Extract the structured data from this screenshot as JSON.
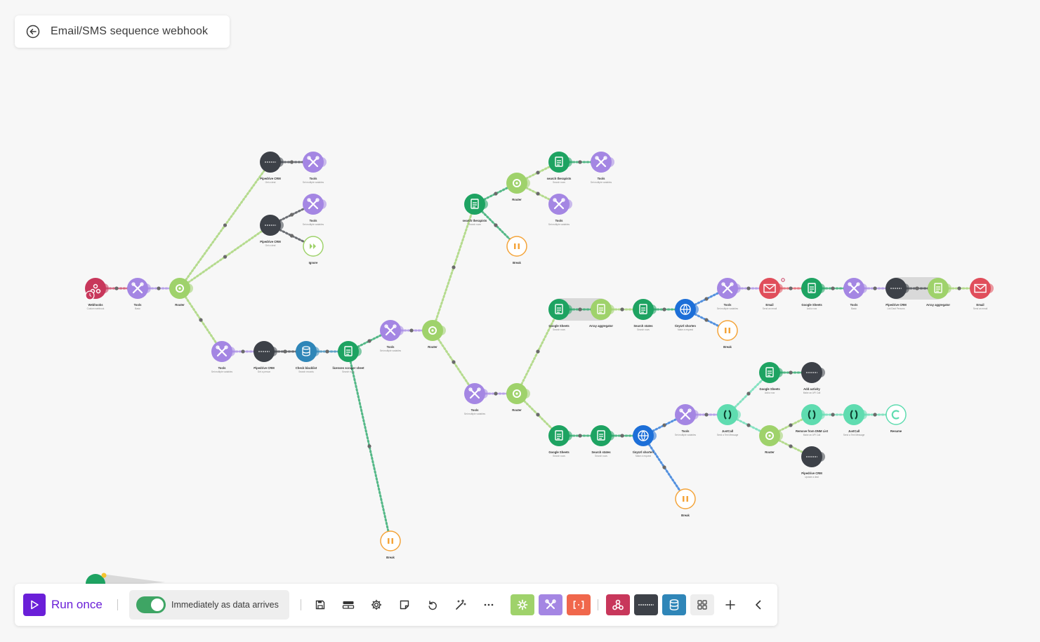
{
  "scenario": {
    "title": "Email/SMS sequence webhook"
  },
  "toolbar": {
    "run_label": "Run once",
    "schedule_label": "Immediately as data arrives",
    "schedule_enabled": true
  },
  "nodes": {
    "webhooks": {
      "label": "Webhooks",
      "sub": "Custom webhook",
      "icon": "webhooks-icon"
    },
    "tools1": {
      "label": "Tools",
      "sub": "Basic",
      "icon": "tools-icon"
    },
    "router1": {
      "label": "Router",
      "icon": "router-icon"
    },
    "pipedrive_a": {
      "label": "Pipedrive CRM",
      "sub": "Get a deal",
      "icon": "pipedrive-icon"
    },
    "tools_a": {
      "label": "Tools",
      "sub": "Set multiple variables",
      "icon": "tools-icon"
    },
    "pipedrive_b": {
      "label": "Pipedrive CRM",
      "sub": "Get a deal",
      "icon": "pipedrive-icon"
    },
    "tools_b": {
      "label": "Tools",
      "sub": "Set multiple variables",
      "icon": "tools-icon"
    },
    "ignore": {
      "label": "Ignore",
      "icon": "ignore-icon"
    },
    "tools_c": {
      "label": "Tools",
      "sub": "Set multiple variables",
      "icon": "tools-icon"
    },
    "pipedrive_c": {
      "label": "Pipedrive CRM",
      "sub": "Get a person",
      "icon": "pipedrive-icon"
    },
    "check_blacklist": {
      "label": "Check blacklist",
      "sub": "Search records",
      "icon": "datastore-icon"
    },
    "licenses": {
      "label": "licenses scraper sheet",
      "sub": "Search rows",
      "icon": "sheets-icon"
    },
    "tools_d": {
      "label": "Tools",
      "sub": "Set multiple variables",
      "icon": "tools-icon"
    },
    "router2": {
      "label": "Router",
      "icon": "router-icon"
    },
    "search_therapists1": {
      "label": "search therapists",
      "sub": "Search rows",
      "icon": "sheets-icon"
    },
    "router3": {
      "label": "Router",
      "icon": "router-icon"
    },
    "search_therapists2": {
      "label": "search therapists",
      "sub": "Search rows",
      "icon": "sheets-icon"
    },
    "tools_e": {
      "label": "Tools",
      "sub": "Set multiple variables",
      "icon": "tools-icon"
    },
    "tools_f": {
      "label": "Tools",
      "sub": "Set multiple variables",
      "icon": "tools-icon"
    },
    "break1": {
      "label": "Break",
      "icon": "break-icon"
    },
    "gs1": {
      "label": "Google Sheets",
      "sub": "Search rows",
      "icon": "sheets-icon"
    },
    "agg1": {
      "label": "Array aggregator",
      "icon": "aggregator-icon"
    },
    "search_states1": {
      "label": "Search states",
      "sub": "Search rows",
      "icon": "sheets-icon"
    },
    "tinyurl1": {
      "label": "tinyUrl shorten",
      "sub": "Make a request",
      "icon": "http-icon"
    },
    "break2": {
      "label": "Break",
      "icon": "break-icon"
    },
    "tools_g": {
      "label": "Tools",
      "sub": "Set multiple variables",
      "icon": "tools-icon"
    },
    "email1": {
      "label": "Email",
      "sub": "Send an email",
      "icon": "email-icon"
    },
    "gs2": {
      "label": "Google Sheets",
      "sub": "Add a row",
      "icon": "sheets-icon"
    },
    "tools_h": {
      "label": "Tools",
      "sub": "Basic",
      "icon": "tools-icon"
    },
    "pipedrive_d": {
      "label": "Pipedrive CRM",
      "sub": "List Deal Persons",
      "icon": "pipedrive-icon"
    },
    "agg2": {
      "label": "Array aggregator",
      "icon": "aggregator-icon"
    },
    "email2": {
      "label": "Email",
      "sub": "Send an email",
      "icon": "email-icon"
    },
    "tools_i": {
      "label": "Tools",
      "sub": "Set multiple variables",
      "icon": "tools-icon"
    },
    "router4": {
      "label": "Router",
      "icon": "router-icon"
    },
    "gs3": {
      "label": "Google Sheets",
      "sub": "Search rows",
      "icon": "sheets-icon"
    },
    "search_states2": {
      "label": "Search states",
      "sub": "Search rows",
      "icon": "sheets-icon"
    },
    "tinyurl2": {
      "label": "tinyUrl shorten",
      "sub": "Make a request",
      "icon": "http-icon"
    },
    "break3": {
      "label": "Break",
      "icon": "break-icon"
    },
    "tools_j": {
      "label": "Tools",
      "sub": "Set multiple variables",
      "icon": "tools-icon"
    },
    "justcall1": {
      "label": "JustCall",
      "sub": "Send a Text Message",
      "icon": "justcall-icon"
    },
    "gs4": {
      "label": "Google Sheets",
      "sub": "Add a row",
      "icon": "sheets-icon"
    },
    "add_activity": {
      "label": "Add activity",
      "sub": "Make an API Call",
      "icon": "pipedrive-icon"
    },
    "router5": {
      "label": "Router",
      "icon": "router-icon"
    },
    "remove_dnm": {
      "label": "Remove from DNM List",
      "sub": "Make an API Call",
      "icon": "justcall-icon"
    },
    "justcall2": {
      "label": "JustCall",
      "sub": "Send a Text Message",
      "icon": "justcall-icon"
    },
    "resume": {
      "label": "Resume",
      "icon": "resume-icon"
    },
    "pipedrive_e": {
      "label": "Pipedrive CRM",
      "sub": "Update a deal",
      "icon": "pipedrive-icon"
    },
    "break4": {
      "label": "Break",
      "icon": "break-icon"
    }
  },
  "colors": {
    "tools": "#a486e3",
    "router": "#9fd26b",
    "sheets": "#1ea362",
    "pipedrive": "#3d4148",
    "webhooks": "#c8375b",
    "datastore": "#2f86b8",
    "http": "#1d6fd8",
    "email": "#e04e5b",
    "justcall": "#5fdcb0",
    "break": "#f4a43a",
    "accent": "#6a1fd8",
    "toggle": "#3ea564"
  }
}
